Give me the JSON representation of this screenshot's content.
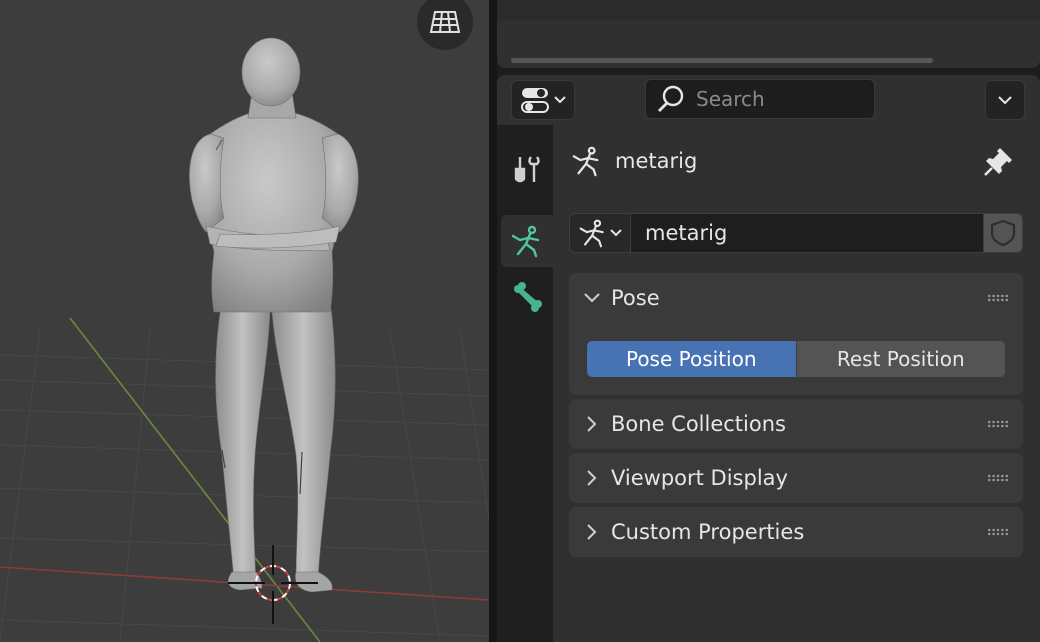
{
  "properties_editor": {
    "search": {
      "placeholder": "Search"
    },
    "context": {
      "object_name": "metarig"
    },
    "armature_datablock": {
      "name": "metarig"
    },
    "panels": [
      {
        "title": "Pose",
        "expanded": true,
        "pose_position_options": [
          "Pose Position",
          "Rest Position"
        ],
        "selected": "Pose Position"
      },
      {
        "title": "Bone Collections",
        "expanded": false
      },
      {
        "title": "Viewport Display",
        "expanded": false
      },
      {
        "title": "Custom Properties",
        "expanded": false
      }
    ],
    "tabs": [
      {
        "icon": "tool-icon",
        "active": false
      },
      {
        "icon": "armature-data-icon",
        "active": true
      },
      {
        "icon": "bone-icon",
        "active": false
      }
    ]
  },
  "colors": {
    "accent_blue": "#4772b3",
    "active_tab_green": "#4fc99b",
    "bone_green": "#46b58c",
    "viewport_bg": "#3d3d3d"
  }
}
